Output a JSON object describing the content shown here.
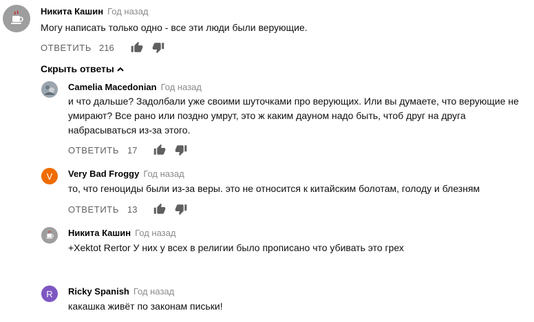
{
  "main_comment": {
    "author": "Никита Кашин",
    "date": "Год назад",
    "text": "Могу написать только одно - все эти люди были верующие.",
    "reply_label": "ОТВЕТИТЬ",
    "likes": "216"
  },
  "hide_replies_label": "Скрыть ответы",
  "replies": [
    {
      "author": "Camelia Macedonian",
      "date": "Год назад",
      "text": "и что дальше? Задолбали уже своими шуточками про верующих. Или вы думаете, что верующие не умирают? Все рано или поздно умрут, это ж каким дауном надо быть, чтоб друг на друга набрасываться из-за этого.",
      "reply_label": "ОТВЕТИТЬ",
      "likes": "17"
    },
    {
      "author": "Very Bad Froggy",
      "date": "Год назад",
      "text": "то, что геноциды были из-за веры. это не относится к китайским болотам, голоду и блезням",
      "reply_label": "ОТВЕТИТЬ",
      "likes": "13",
      "avatar_letter": "V",
      "avatar_color": "#ef6c00"
    },
    {
      "author": "Никита Кашин",
      "date": "Год назад",
      "text": "+Xektot Rertor У них у всех в религии было прописано что убивать это грех"
    },
    {
      "author": "Ricky Spanish",
      "date": "Год назад",
      "text": "какашка живёт по законам письки!",
      "avatar_letter": "R",
      "avatar_color": "#7e57c2"
    }
  ]
}
